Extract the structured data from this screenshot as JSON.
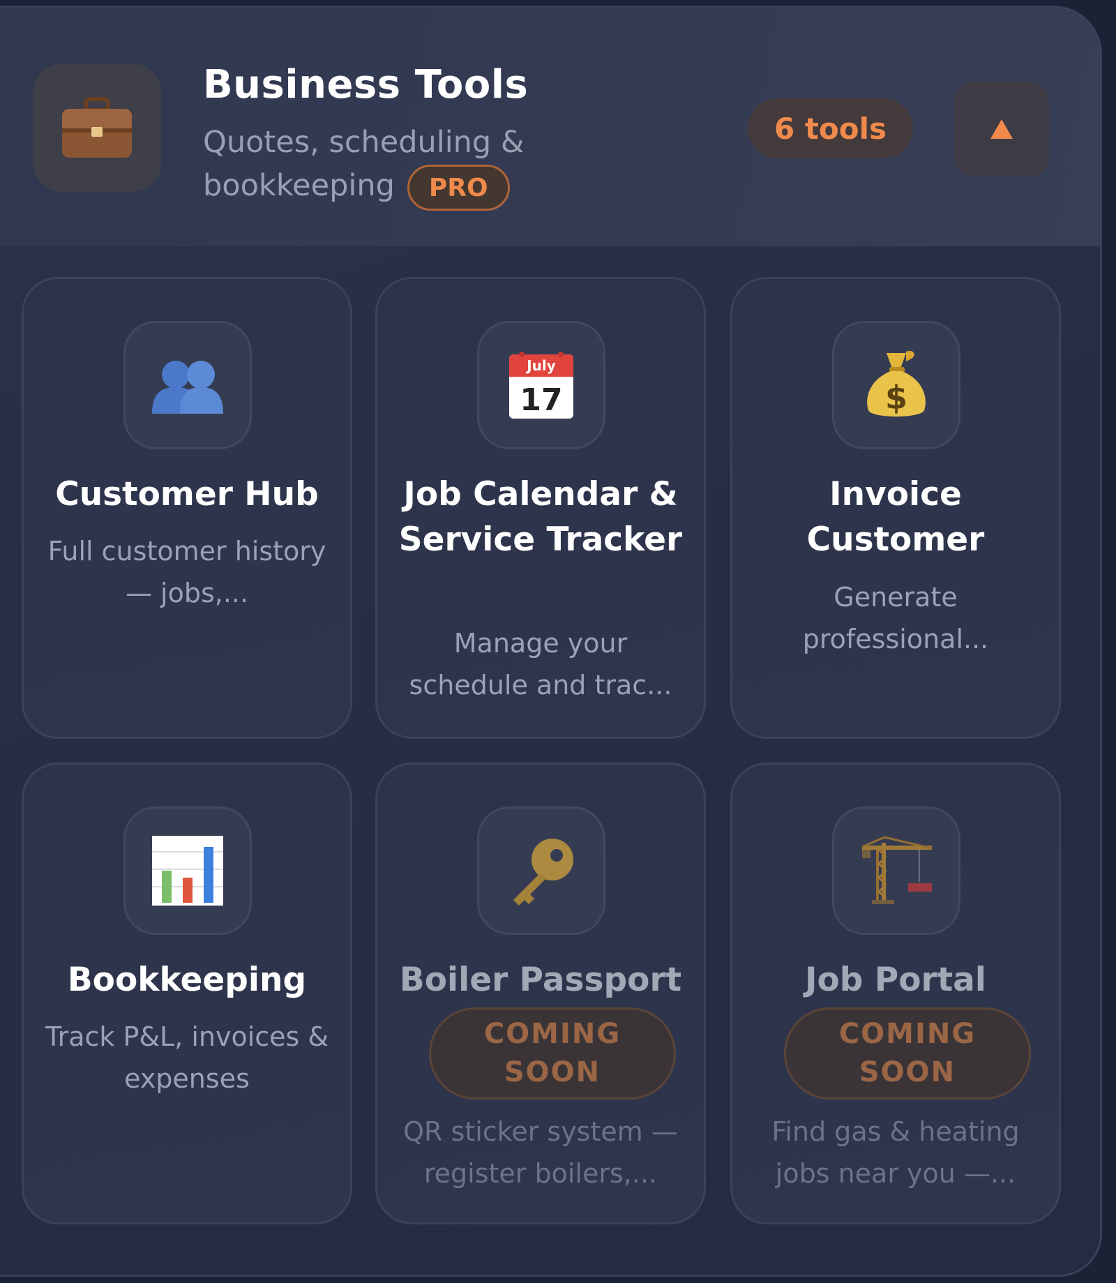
{
  "header": {
    "title": "Business Tools",
    "subtitle": "Quotes, scheduling & bookkeeping",
    "pro_badge": "PRO",
    "tool_count": "6 tools",
    "collapse_icon": "triangle-up-icon",
    "header_icon": "briefcase-icon"
  },
  "colors": {
    "accent": "#ef8a4c",
    "panel_bg": "#2b3249",
    "card_bg": "#2c334a"
  },
  "tools": [
    {
      "title": "Customer Hub",
      "description": "Full customer history — jobs,...",
      "icon": "people-icon",
      "coming_soon": ""
    },
    {
      "title": "Job Calendar & Service Tracker",
      "description": "Manage your schedule and trac...",
      "icon": "calendar-icon",
      "calendar_month": "July",
      "calendar_day": "17",
      "coming_soon": ""
    },
    {
      "title": "Invoice Customer",
      "description": "Generate professional...",
      "icon": "money-bag-icon",
      "coming_soon": ""
    },
    {
      "title": "Bookkeeping",
      "description": "Track P&L, invoices & expenses",
      "icon": "bar-chart-icon",
      "coming_soon": ""
    },
    {
      "title": "Boiler Passport",
      "description": "QR sticker system — register boilers,...",
      "icon": "key-icon",
      "coming_soon": "COMING SOON"
    },
    {
      "title": "Job Portal",
      "description": "Find gas & heating jobs near you —...",
      "icon": "crane-icon",
      "coming_soon": "COMING SOON"
    }
  ]
}
